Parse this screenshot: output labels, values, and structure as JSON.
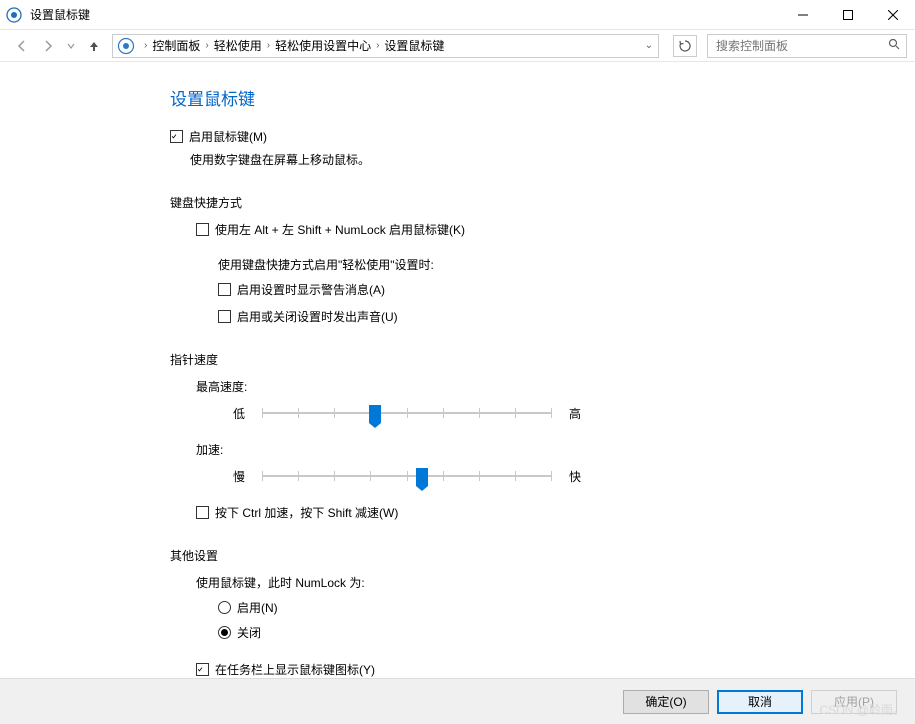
{
  "window": {
    "title": "设置鼠标键"
  },
  "nav": {
    "crumbs": [
      "控制面板",
      "轻松使用",
      "轻松使用设置中心",
      "设置鼠标键"
    ],
    "search_placeholder": "搜索控制面板"
  },
  "header": "设置鼠标键",
  "enable": {
    "label": "启用鼠标键(M)",
    "checked": true,
    "desc": "使用数字键盘在屏幕上移动鼠标。"
  },
  "shortcut": {
    "heading": "键盘快捷方式",
    "use_shortcut": {
      "label": "使用左 Alt + 左 Shift + NumLock 启用鼠标键(K)",
      "checked": false
    },
    "when_heading": "使用键盘快捷方式启用\"轻松使用\"设置时:",
    "show_warning": {
      "label": "启用设置时显示警告消息(A)",
      "checked": false
    },
    "play_sound": {
      "label": "启用或关闭设置时发出声音(U)",
      "checked": false
    }
  },
  "speed": {
    "heading": "指针速度",
    "top_label": "最高速度:",
    "top": {
      "low": "低",
      "high": "高",
      "value": 39
    },
    "accel_label": "加速:",
    "accel": {
      "low": "慢",
      "high": "快",
      "value": 55
    },
    "ctrl_shift": {
      "label": "按下 Ctrl 加速，按下 Shift 减速(W)",
      "checked": false
    }
  },
  "other": {
    "heading": "其他设置",
    "numlock_heading": "使用鼠标键，此时 NumLock 为:",
    "radio_on": "启用(N)",
    "radio_off": "关闭",
    "radio_value": "off",
    "taskbar": {
      "label": "在任务栏上显示鼠标键图标(Y)",
      "checked": true
    }
  },
  "buttons": {
    "ok": "确定(O)",
    "cancel": "取消",
    "apply": "应用(P)"
  },
  "watermark": "CSDN @聆雨。"
}
